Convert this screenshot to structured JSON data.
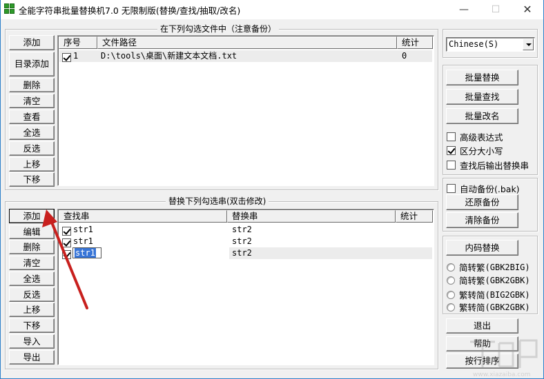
{
  "window": {
    "title": "全能字符串批量替换机7.0 无限制版(替换/查找/抽取/改名)",
    "controls": {
      "minimize": "—",
      "maximize": "☐",
      "close": "✕"
    }
  },
  "files_panel": {
    "title": "在下列勾选文件中（注意备份）",
    "buttons": [
      "添加",
      "目录添加",
      "删除",
      "清空",
      "查看",
      "全选",
      "反选",
      "上移",
      "下移"
    ],
    "columns": [
      "序号",
      "文件路径",
      "统计"
    ],
    "rows": [
      {
        "checked": true,
        "index": "1",
        "path": "D:\\tools\\桌面\\新建文本文档.txt",
        "count": "0"
      }
    ]
  },
  "replace_panel": {
    "title": "替换下列勾选串(双击修改)",
    "buttons": [
      "添加",
      "编辑",
      "删除",
      "清空",
      "全选",
      "反选",
      "上移",
      "下移",
      "导入",
      "导出"
    ],
    "columns": [
      "查找串",
      "替换串",
      "统计"
    ],
    "rows": [
      {
        "checked": true,
        "find": "str1",
        "replace": "str2",
        "count": ""
      },
      {
        "checked": true,
        "find": "str1",
        "replace": "str2",
        "count": ""
      },
      {
        "checked": true,
        "find": "str1",
        "replace": "str2",
        "count": "",
        "editing": true
      }
    ]
  },
  "language": {
    "selected": "Chinese(S)"
  },
  "batch_panel": {
    "buttons": [
      "批量替换",
      "批量查找",
      "批量改名"
    ],
    "options": [
      {
        "label": "高级表达式",
        "checked": false
      },
      {
        "label": "区分大小写",
        "checked": true
      },
      {
        "label": "查找后输出替换串",
        "checked": false
      }
    ]
  },
  "backup_panel": {
    "auto_backup": {
      "label": "自动备份(.bak)",
      "checked": false
    },
    "buttons": [
      "还原备份",
      "清除备份"
    ]
  },
  "encoding_panel": {
    "button": "内码替换",
    "radios": [
      {
        "label": "简转繁",
        "code": "(GBK2BIG)",
        "selected": false
      },
      {
        "label": "简转繁",
        "code": "(GBK2GBK)",
        "selected": false
      },
      {
        "label": "繁转简",
        "code": "(BIG2GBK)",
        "selected": false
      },
      {
        "label": "繁转简",
        "code": "(GBK2GBK)",
        "selected": false
      }
    ]
  },
  "bottom_buttons": [
    "退出",
    "帮助",
    "按行排序"
  ],
  "annotation": {
    "arrow_color": "#c8201e"
  },
  "watermark": {
    "text": "www.xiazaiba.com"
  }
}
